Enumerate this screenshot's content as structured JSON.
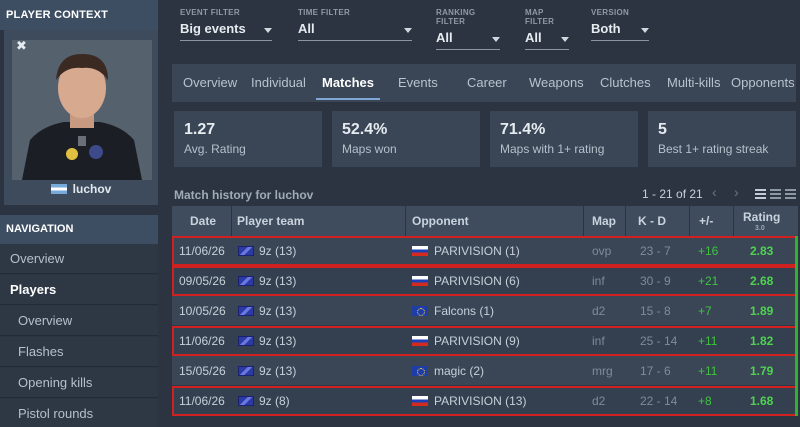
{
  "sidebar": {
    "player_context_title": "PLAYER CONTEXT",
    "close_symbol": "✖",
    "player_name": "luchov",
    "navigation_title": "NAVIGATION",
    "nav_items": [
      {
        "label": "Overview"
      },
      {
        "label": "Players"
      },
      {
        "label": "Overview"
      },
      {
        "label": "Flashes"
      },
      {
        "label": "Opening kills"
      },
      {
        "label": "Pistol rounds"
      }
    ]
  },
  "filters": [
    {
      "label": "EVENT FILTER",
      "value": "Big events"
    },
    {
      "label": "TIME FILTER",
      "value": "All"
    },
    {
      "label": "RANKING FILTER",
      "value": "All"
    },
    {
      "label": "MAP FILTER",
      "value": "All"
    },
    {
      "label": "VERSION",
      "value": "Both"
    }
  ],
  "tabs": [
    "Overview",
    "Individual",
    "Matches",
    "Events",
    "Career",
    "Weapons",
    "Clutches",
    "Multi-kills",
    "Opponents"
  ],
  "active_tab": "Matches",
  "stats": [
    {
      "value": "1.27",
      "label": "Avg. Rating"
    },
    {
      "value": "52.4%",
      "label": "Maps won"
    },
    {
      "value": "71.4%",
      "label": "Maps with 1+ rating"
    },
    {
      "value": "5",
      "label": "Best 1+ rating streak"
    }
  ],
  "match_history": {
    "title": "Match history for luchov",
    "pagination": "1 - 21 of 21",
    "prev_symbol": "‹",
    "next_symbol": "›",
    "columns": {
      "date": "Date",
      "player_team": "Player team",
      "opponent": "Opponent",
      "map": "Map",
      "kd": "K - D",
      "diff": "+/-",
      "rating": "Rating",
      "rating_sub": "3.0"
    },
    "rows": [
      {
        "date": "11/06/26",
        "team": "9z (13)",
        "opponent": "PARIVISION (1)",
        "opp_flag": "russia-flag",
        "map": "ovp",
        "kd": "23 - 7",
        "diff": "+16",
        "rating": "2.83",
        "highlighted": true
      },
      {
        "date": "09/05/26",
        "team": "9z (13)",
        "opponent": "PARIVISION (6)",
        "opp_flag": "russia-flag",
        "map": "inf",
        "kd": "30 - 9",
        "diff": "+21",
        "rating": "2.68",
        "highlighted": true
      },
      {
        "date": "10/05/26",
        "team": "9z (13)",
        "opponent": "Falcons (1)",
        "opp_flag": "europe-flag",
        "map": "d2",
        "kd": "15 - 8",
        "diff": "+7",
        "rating": "1.89",
        "highlighted": false
      },
      {
        "date": "11/06/26",
        "team": "9z (13)",
        "opponent": "PARIVISION (9)",
        "opp_flag": "russia-flag",
        "map": "inf",
        "kd": "25 - 14",
        "diff": "+11",
        "rating": "1.82",
        "highlighted": true
      },
      {
        "date": "15/05/26",
        "team": "9z (13)",
        "opponent": "magic (2)",
        "opp_flag": "europe-flag",
        "map": "mrg",
        "kd": "17 - 6",
        "diff": "+11",
        "rating": "1.79",
        "highlighted": false
      },
      {
        "date": "11/06/26",
        "team": "9z (8)",
        "opponent": "PARIVISION (13)",
        "opp_flag": "russia-flag",
        "map": "d2",
        "kd": "22 - 14",
        "diff": "+8",
        "rating": "1.68",
        "highlighted": true
      }
    ]
  },
  "colors": {
    "highlight_border": "#d02020",
    "positive": "#3ec43e",
    "header_bg": "#3d4e63"
  }
}
